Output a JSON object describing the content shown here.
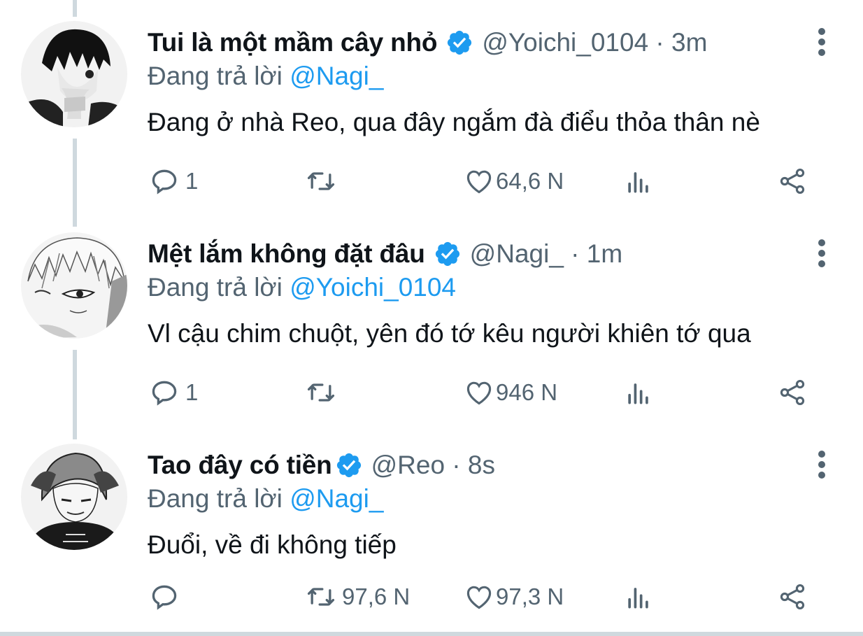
{
  "replying_label": "Đang trả lời",
  "tweets": [
    {
      "display_name": "Tui là một mầm cây nhỏ",
      "handle_time": "@Yoichi_0104 · 3m",
      "replying_to": "@Nagi_",
      "text": "Đang ở nhà Reo, qua đây ngắm đà điểu thỏa thân nè",
      "reply_count": "1",
      "retweet_count": "",
      "like_count": "64,6 N"
    },
    {
      "display_name": "Mệt lắm không đặt đâu",
      "handle_time": "@Nagi_ · 1m",
      "replying_to": "@Yoichi_0104",
      "text": "Vl cậu chim chuột, yên đó tớ kêu người khiên tớ qua",
      "reply_count": "1",
      "retweet_count": "",
      "like_count": "946 N"
    },
    {
      "display_name": "Tao đây có tiền",
      "handle_time": "@Reo · 8s",
      "replying_to": "@Nagi_",
      "text": "Đuổi, về đi không tiếp",
      "reply_count": "",
      "retweet_count": "97,6 N",
      "like_count": "97,3 N"
    }
  ],
  "icons": {
    "reply": "reply-icon",
    "retweet": "retweet-icon",
    "like": "heart-icon",
    "views": "views-icon",
    "share": "share-icon",
    "verified": "verified-badge-icon",
    "more": "more-vertical-icon"
  },
  "colors": {
    "accent": "#1d9bf0",
    "secondary_text": "#536471",
    "primary_text": "#0f1419",
    "thread_line": "#cfd9de"
  }
}
